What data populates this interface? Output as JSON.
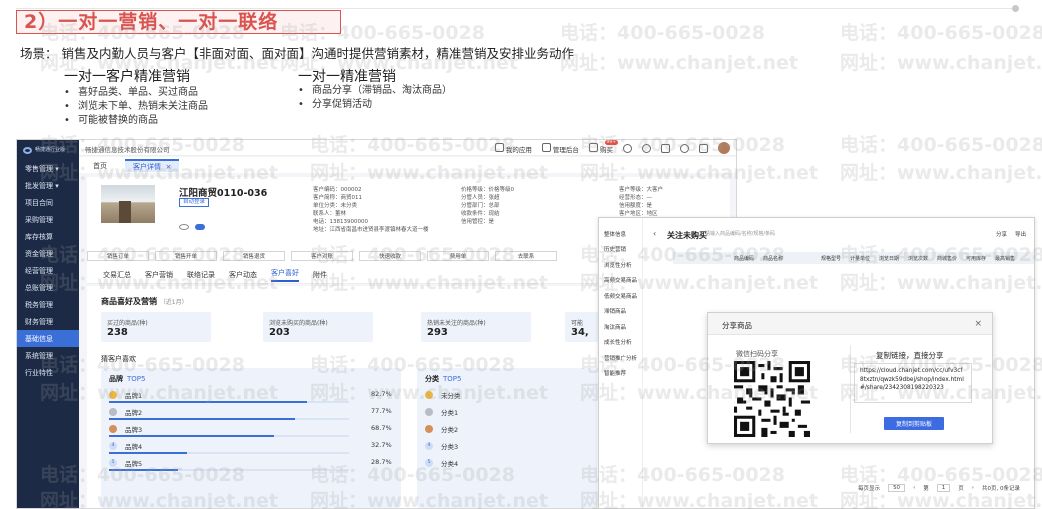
{
  "slide": {
    "title": "2）一对一营销、一对一联络",
    "scene": "场景：  销售及内勤人员与客户【非面对面、面对面】沟通时提供营销素材，精准营销及安排业务动作",
    "left_subtitle": "一对一客户精准营销",
    "left_bullets": [
      "喜好品类、单品、买过商品",
      "浏览未下单、热销未关注商品",
      "可能被替换的商品"
    ],
    "right_subtitle": "一对一精准营销",
    "right_bullets": [
      "商品分享（滞销品、淘汰商品）",
      "分享促销活动"
    ],
    "watermark_phone": "电话：400-665-0028",
    "watermark_site": "网址：www.chanjet.net"
  },
  "app": {
    "logo_text": "畅捷通行业版",
    "company": "畅捷通信息技术股份有限公司",
    "top_actions": [
      "我的应用",
      "管理后台",
      "购买"
    ],
    "cart_badge": "99+",
    "nav": [
      "零售管理 ▾",
      "批发管理 ▾",
      "项目合同",
      "采购管理",
      "库存核算",
      "资金管理",
      "经营管理",
      "总账管理",
      "税务管理",
      "财务管理",
      "基础信息",
      "系统管理",
      "行业特性"
    ],
    "nav_active": "基础信息",
    "tab_home": "首页",
    "tab_current": "客户详情",
    "tab_close": "×",
    "customer": {
      "name": "江阳商贸0110-036",
      "tag": "自动登录",
      "info_col1": [
        "客户编码：000002",
        "客户简称：商贸011",
        "单位分类：未分类",
        "联系人：董林",
        "电话：13813900000",
        "地址：江西省南昌市进贤县李渡镇林春大道一楼"
      ],
      "info_col2": [
        "价格等级：价格等级0",
        "分管人员：张超",
        "分管部门：总部",
        "收款条件：现结",
        "信用管控：是"
      ],
      "info_col3": [
        "客户等级：大客户",
        "经营形态：—",
        "信用额度：是",
        "客户地区：地区"
      ]
    },
    "actions": [
      "销售订单",
      "销售开单",
      "销售退货",
      "客户对账",
      "快速收款",
      "费用单",
      "去联系"
    ],
    "tabs": [
      "交易汇总",
      "客户营销",
      "联络记录",
      "客户动态",
      "客户喜好",
      "附件"
    ],
    "tab_active": "客户喜好",
    "pref": {
      "title": "商品喜好及营销",
      "range": "（近1月）",
      "stats": [
        {
          "label": "买过的商品(种)",
          "value": "238"
        },
        {
          "label": "浏览未购买的商品(种)",
          "value": "203"
        },
        {
          "label": "热销未关注的商品(种)",
          "value": "293"
        },
        {
          "label": "可能",
          "value": "34,"
        }
      ],
      "like_title": "猜客户喜欢",
      "brand": {
        "title": "品牌",
        "top": "TOP5",
        "rows": [
          {
            "rank": "",
            "name": "品牌1",
            "pct": "82.7%"
          },
          {
            "rank": "",
            "name": "品牌2",
            "pct": "77.7%"
          },
          {
            "rank": "",
            "name": "品牌3",
            "pct": "68.7%"
          },
          {
            "rank": "4",
            "name": "品牌4",
            "pct": "32.7%"
          },
          {
            "rank": "5",
            "name": "品牌5",
            "pct": "28.7%"
          }
        ]
      },
      "category": {
        "title": "分类",
        "top": "TOP5",
        "rows": [
          {
            "rank": "",
            "name": "未分类"
          },
          {
            "rank": "",
            "name": "分类1"
          },
          {
            "rank": "",
            "name": "分类2"
          },
          {
            "rank": "4",
            "name": "分类3"
          },
          {
            "rank": "5",
            "name": "分类4"
          }
        ]
      },
      "brand_fill": [
        0.827,
        0.777,
        0.687,
        0.327,
        0.287
      ]
    }
  },
  "app2": {
    "side": [
      "整体信息",
      "历史营销",
      "浏览性分析",
      "高频交易商品",
      "低频交易商品",
      "滞销商品",
      "淘汰商品",
      "成长性分析",
      "营销推广分析",
      "智能推荐"
    ],
    "title": "关注未购买",
    "search_placeholder": "请输入商品编码/名称/规格/条码",
    "right_actions": [
      "分享",
      "导出"
    ],
    "columns": [
      "",
      "",
      "商品编码",
      "商品名称",
      "",
      "规格型号",
      "计量单位",
      "浏览日期",
      "浏览次数",
      "商城售价",
      "可用库存",
      "最高销售"
    ],
    "modal": {
      "title": "分享商品",
      "close": "×",
      "qr_label": "微信扫码分享",
      "copy_title": "复制链接，直接分享",
      "url": "https://cloud.chanjet.com/cc/ufv3cf8txztn/qwzk59dbej/shop/index.html#/share/2342308198220323",
      "copy_button": "复制到剪贴板"
    },
    "pager": {
      "size_label": "每页显示",
      "size": "50",
      "page_label": "第",
      "page": "1",
      "page_unit": "页",
      "total": "共0页, 0条记录"
    }
  }
}
